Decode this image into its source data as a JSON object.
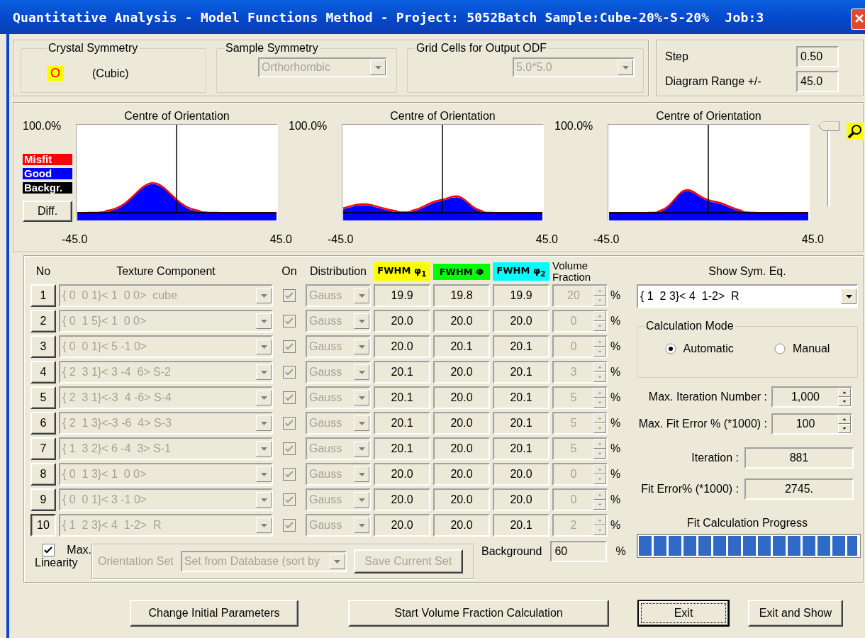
{
  "window": {
    "title": "Quantitative Analysis - Model Functions Method - Project: 5052Batch Sample:Cube-20%-S-20%  Job:3"
  },
  "crystal_symmetry": {
    "label": "Crystal Symmetry",
    "symbol": "O",
    "name": "(Cubic)"
  },
  "sample_symmetry": {
    "label": "Sample Symmetry",
    "value": "Orthorhombic",
    "disabled": true
  },
  "grid_cells": {
    "label": "Grid Cells for Output ODF",
    "value": "5.0*5.0",
    "disabled": true
  },
  "step": {
    "label": "Step",
    "value": "0.50"
  },
  "diagram_range": {
    "label": "Diagram Range +/-",
    "value": "45.0"
  },
  "legend": [
    {
      "label": "Misfit",
      "color": "#ff0000"
    },
    {
      "label": "Good",
      "color": "#0000ff"
    },
    {
      "label": "Backgr.",
      "color": "#000000"
    }
  ],
  "diff_button": "Diff.",
  "plots": [
    {
      "title": "Centre of Orientation",
      "y_max": "100.0%",
      "x_min": "-45.0",
      "x_max": "45.0"
    },
    {
      "title": "Centre of Orientation",
      "y_max": "100.0%",
      "x_min": "-45.0",
      "x_max": "45.0"
    },
    {
      "title": "Centre of Orientation",
      "y_max": "100.0%",
      "x_min": "-45.0",
      "x_max": "45.0"
    }
  ],
  "zoom_slider": {
    "level": 1
  },
  "table": {
    "columns": [
      {
        "label": "No"
      },
      {
        "label": "Texture Component"
      },
      {
        "label": "On"
      },
      {
        "label": "Distribution"
      },
      {
        "label": "FWHM φ$_{1}$",
        "color": "#ffff00"
      },
      {
        "label": "FWHM Φ",
        "color": "#00ff00"
      },
      {
        "label": "FWHM φ$_{2}$",
        "color": "#00ffff"
      },
      {
        "label": "Volume Fraction"
      }
    ],
    "rows": [
      {
        "no": "1",
        "selected": false,
        "disabled": true,
        "component": "{ 0  0 1}< 1  0 0>  cube",
        "on": true,
        "distribution": "Gauss",
        "fwhm_1": "19.9",
        "fwhm_2": "19.8",
        "fwhm_3": "19.9",
        "volume_fraction": "20",
        "unit": "%"
      },
      {
        "no": "2",
        "selected": false,
        "disabled": true,
        "component": "{ 0  1 5}< 1  0 0>",
        "on": true,
        "distribution": "Gauss",
        "fwhm_1": "20.0",
        "fwhm_2": "20.0",
        "fwhm_3": "20.0",
        "volume_fraction": "0",
        "unit": "%"
      },
      {
        "no": "3",
        "selected": false,
        "disabled": true,
        "component": "{ 0  0 1}< 5 -1 0>",
        "on": true,
        "distribution": "Gauss",
        "fwhm_1": "20.0",
        "fwhm_2": "20.1",
        "fwhm_3": "20.1",
        "volume_fraction": "0",
        "unit": "%"
      },
      {
        "no": "4",
        "selected": false,
        "disabled": true,
        "component": "{ 2  3 1}< 3 -4  6> S-2",
        "on": true,
        "distribution": "Gauss",
        "fwhm_1": "20.1",
        "fwhm_2": "20.0",
        "fwhm_3": "20.1",
        "volume_fraction": "3",
        "unit": "%"
      },
      {
        "no": "5",
        "selected": false,
        "disabled": true,
        "component": "{ 2  3 1}<-3  4 -6> S-4",
        "on": true,
        "distribution": "Gauss",
        "fwhm_1": "20.1",
        "fwhm_2": "20.0",
        "fwhm_3": "20.1",
        "volume_fraction": "5",
        "unit": "%"
      },
      {
        "no": "6",
        "selected": false,
        "disabled": true,
        "component": "{ 2  1 3}<-3 -6  4> S-3",
        "on": true,
        "distribution": "Gauss",
        "fwhm_1": "20.1",
        "fwhm_2": "20.0",
        "fwhm_3": "20.1",
        "volume_fraction": "5",
        "unit": "%"
      },
      {
        "no": "7",
        "selected": false,
        "disabled": true,
        "component": "{ 1  3 2}< 6 -4  3> S-1",
        "on": true,
        "distribution": "Gauss",
        "fwhm_1": "20.1",
        "fwhm_2": "20.0",
        "fwhm_3": "20.1",
        "volume_fraction": "5",
        "unit": "%"
      },
      {
        "no": "8",
        "selected": false,
        "disabled": true,
        "component": "{ 0  1 3}< 1  0 0>",
        "on": true,
        "distribution": "Gauss",
        "fwhm_1": "20.0",
        "fwhm_2": "20.0",
        "fwhm_3": "20.0",
        "volume_fraction": "0",
        "unit": "%"
      },
      {
        "no": "9",
        "selected": false,
        "disabled": true,
        "component": "{ 0  0 1}< 3 -1 0>",
        "on": true,
        "distribution": "Gauss",
        "fwhm_1": "20.0",
        "fwhm_2": "20.0",
        "fwhm_3": "20.0",
        "volume_fraction": "0",
        "unit": "%"
      },
      {
        "no": "10",
        "selected": true,
        "disabled": true,
        "component": "{ 1  2 3}< 4  1-2>  R",
        "on": true,
        "distribution": "Gauss",
        "fwhm_1": "20.0",
        "fwhm_2": "20.0",
        "fwhm_3": "20.1",
        "volume_fraction": "2",
        "unit": "%"
      }
    ]
  },
  "max_linearity": {
    "label_1": "Max.",
    "label_2": "Linearity",
    "checked": true
  },
  "orientation_set": {
    "label": "Orientation Set",
    "value": "Set from Database (sort by",
    "button": "Save Current Set",
    "disabled": true
  },
  "background": {
    "label": "Background",
    "value": "60",
    "unit": "%"
  },
  "show_sym_eq": {
    "label": "Show Sym. Eq.",
    "value": "{ 1  2 3}< 4  1-2>  R"
  },
  "calculation_mode": {
    "label": "Calculation Mode",
    "options": [
      {
        "label": "Automatic",
        "selected": true
      },
      {
        "label": "Manual",
        "selected": false
      }
    ]
  },
  "max_iteration": {
    "label": "Max. Iteration Number :",
    "value": "1,000"
  },
  "max_fit_error": {
    "label": "Max. Fit Error % (*1000) :",
    "value": "100"
  },
  "iteration": {
    "label": "Iteration :",
    "value": "881"
  },
  "fit_error": {
    "label": "Fit Error% (*1000) :",
    "value": "2745."
  },
  "progress": {
    "label": "Fit Calculation Progress",
    "level": 0.995
  },
  "buttons": [
    {
      "label": "Change Initial Parameters",
      "focused": false
    },
    {
      "label": "Start Volume Fraction Calculation",
      "focused": false
    },
    {
      "label": "Exit",
      "focused": true
    },
    {
      "label": "Exit and Show",
      "focused": false
    }
  ]
}
